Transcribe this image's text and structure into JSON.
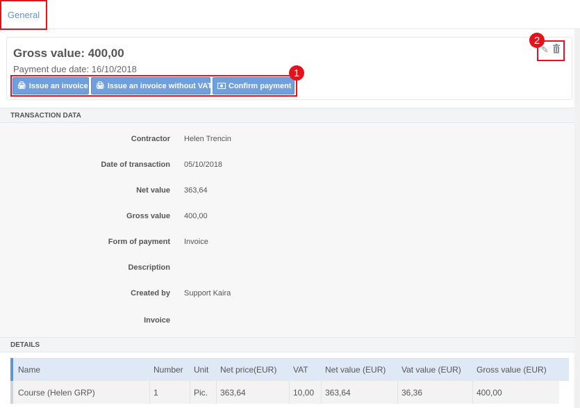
{
  "tabs": [
    {
      "label": "General",
      "active": true
    }
  ],
  "summary": {
    "gross_value": "Gross value: 400,00",
    "payment_due": "Payment due date: 16/10/2018",
    "buttons": {
      "issue_invoice": "Issue an invoice",
      "issue_invoice_no_vat": "Issue an invoice without VAT",
      "confirm_payment": "Confirm payment"
    }
  },
  "annotations": {
    "badge1": "1",
    "badge2": "2"
  },
  "icons": {
    "edit": "pencil-icon",
    "delete": "trash-icon",
    "print": "print-icon",
    "money": "money-icon"
  },
  "colors": {
    "accent": "#6f9fdc",
    "highlight": "#e5121b",
    "tab_text": "#5a95d6"
  },
  "sections": {
    "transaction": "TRANSACTION DATA",
    "details": "DETAILS"
  },
  "transaction": [
    {
      "label": "Contractor",
      "value": "Helen Trencin"
    },
    {
      "label": "Date of transaction",
      "value": "05/10/2018"
    },
    {
      "label": "Net value",
      "value": "363,64"
    },
    {
      "label": "Gross value",
      "value": "400,00"
    },
    {
      "label": "Form of payment",
      "value": "Invoice"
    },
    {
      "label": "Description",
      "value": ""
    },
    {
      "label": "Created by",
      "value": "Support Kaira"
    },
    {
      "label": "Invoice",
      "value": ""
    }
  ],
  "details": {
    "columns": [
      "Name",
      "Number",
      "Unit",
      "Net price(EUR)",
      "VAT",
      "Net value (EUR)",
      "Vat value (EUR)",
      "Gross value (EUR)"
    ],
    "rows": [
      [
        "Course (Helen GRP)",
        "1",
        "Pic.",
        "363,64",
        "10,00",
        "363,64",
        "36,36",
        "400,00"
      ]
    ]
  }
}
